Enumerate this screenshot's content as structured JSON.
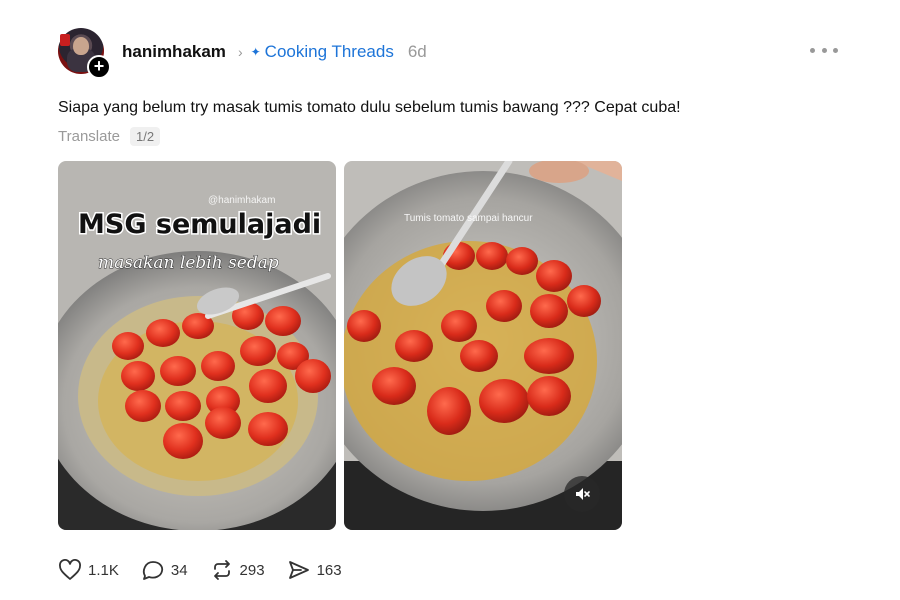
{
  "post": {
    "username": "hanimhakam",
    "community": "Cooking Threads",
    "age": "6d",
    "text": "Siapa yang belum try masak tumis tomato dulu sebelum tumis bawang ??? Cepat cuba!",
    "translate_label": "Translate",
    "media_counter": "1/2"
  },
  "media": [
    {
      "overlay_handle": "@hanimhakam",
      "overlay_title": "MSG semulajadi",
      "overlay_subtitle": "masakan lebih sedap"
    },
    {
      "overlay_caption": "Tumis tomato sampai hancur"
    }
  ],
  "actions": {
    "likes": "1.1K",
    "replies": "34",
    "reposts": "293",
    "shares": "163"
  },
  "icons": {
    "like": "heart-icon",
    "reply": "comment-icon",
    "repost": "repost-icon",
    "share": "send-icon",
    "mute": "mute-icon",
    "more": "more-icon",
    "community": "community-icon",
    "follow": "plus-icon"
  },
  "colors": {
    "community": "#1d74d8",
    "muted_text": "#999999",
    "tomato": "#e0301e",
    "pan": "#b9b9b9"
  }
}
